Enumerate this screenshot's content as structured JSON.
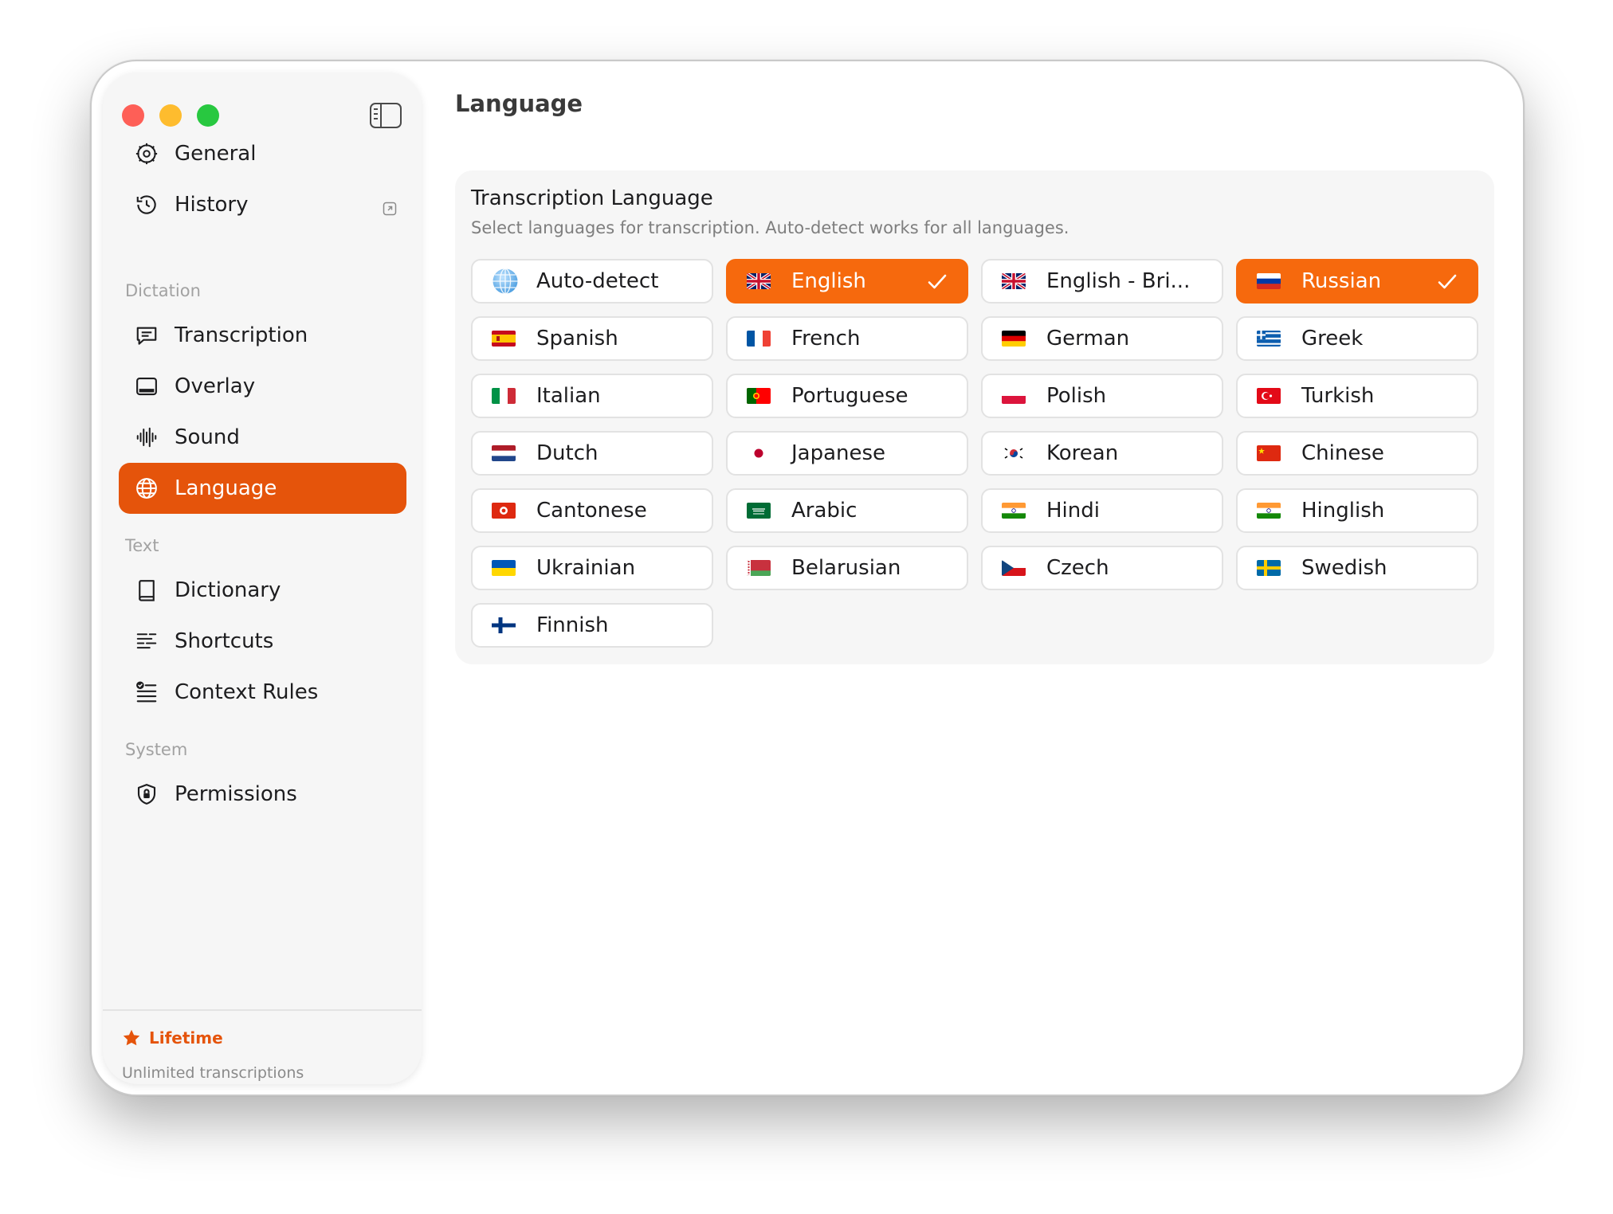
{
  "window": {
    "page_title": "Language"
  },
  "sidebar": {
    "top_items": [
      {
        "label": "General",
        "icon": "gear-icon"
      },
      {
        "label": "History",
        "icon": "history-icon"
      }
    ],
    "sections": [
      {
        "label": "Dictation",
        "items": [
          {
            "label": "Transcription",
            "icon": "transcript-bubble-icon"
          },
          {
            "label": "Overlay",
            "icon": "overlay-window-icon"
          },
          {
            "label": "Sound",
            "icon": "waveform-icon"
          },
          {
            "label": "Language",
            "icon": "globe-icon",
            "active": true
          }
        ]
      },
      {
        "label": "Text",
        "items": [
          {
            "label": "Dictionary",
            "icon": "book-icon"
          },
          {
            "label": "Shortcuts",
            "icon": "text-lines-icon"
          },
          {
            "label": "Context Rules",
            "icon": "checklist-icon"
          }
        ]
      },
      {
        "label": "System",
        "items": [
          {
            "label": "Permissions",
            "icon": "shield-lock-icon"
          }
        ]
      }
    ],
    "plan": {
      "label": "Lifetime",
      "subtitle": "Unlimited transcriptions"
    }
  },
  "transcription": {
    "title": "Transcription Language",
    "subtitle": "Select languages for transcription. Auto-detect works for all languages.",
    "languages": [
      {
        "label": "Auto-detect",
        "flag": "globe",
        "selected": false
      },
      {
        "label": "English",
        "flag": "gb",
        "selected": true
      },
      {
        "label": "English - Bri...",
        "flag": "gb",
        "selected": false
      },
      {
        "label": "Russian",
        "flag": "ru",
        "selected": true
      },
      {
        "label": "Spanish",
        "flag": "es",
        "selected": false
      },
      {
        "label": "French",
        "flag": "fr",
        "selected": false
      },
      {
        "label": "German",
        "flag": "de",
        "selected": false
      },
      {
        "label": "Greek",
        "flag": "gr",
        "selected": false
      },
      {
        "label": "Italian",
        "flag": "it",
        "selected": false
      },
      {
        "label": "Portuguese",
        "flag": "pt",
        "selected": false
      },
      {
        "label": "Polish",
        "flag": "pl",
        "selected": false
      },
      {
        "label": "Turkish",
        "flag": "tr",
        "selected": false
      },
      {
        "label": "Dutch",
        "flag": "nl",
        "selected": false
      },
      {
        "label": "Japanese",
        "flag": "jp",
        "selected": false
      },
      {
        "label": "Korean",
        "flag": "kr",
        "selected": false
      },
      {
        "label": "Chinese",
        "flag": "cn",
        "selected": false
      },
      {
        "label": "Cantonese",
        "flag": "hk",
        "selected": false
      },
      {
        "label": "Arabic",
        "flag": "sa",
        "selected": false
      },
      {
        "label": "Hindi",
        "flag": "in",
        "selected": false
      },
      {
        "label": "Hinglish",
        "flag": "in",
        "selected": false
      },
      {
        "label": "Ukrainian",
        "flag": "ua",
        "selected": false
      },
      {
        "label": "Belarusian",
        "flag": "by",
        "selected": false
      },
      {
        "label": "Czech",
        "flag": "cz",
        "selected": false
      },
      {
        "label": "Swedish",
        "flag": "se",
        "selected": false
      },
      {
        "label": "Finnish",
        "flag": "fi",
        "selected": false
      }
    ]
  },
  "colors": {
    "accent": "#f6690d",
    "sidebar_active": "#e5540b"
  }
}
